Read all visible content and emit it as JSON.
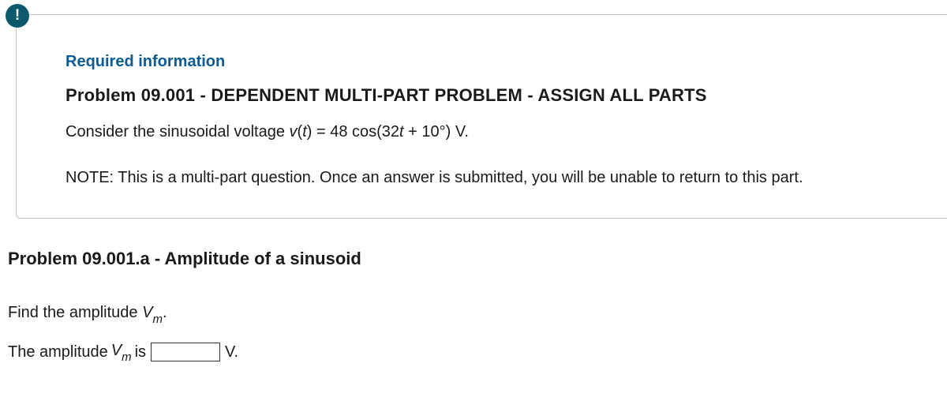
{
  "info_icon": "!",
  "required_label": "Required information",
  "problem_title": "Problem 09.001 - DEPENDENT MULTI-PART PROBLEM - ASSIGN ALL PARTS",
  "problem_desc_prefix": "Consider the sinusoidal voltage ",
  "problem_desc_var_v": "v",
  "problem_desc_var_t_open": "(",
  "problem_desc_var_t": "t",
  "problem_desc_var_t_close": ")",
  "problem_desc_eq": " = 48 cos(32",
  "problem_desc_t2": "t",
  "problem_desc_suffix": " + 10°) V.",
  "note_text": "NOTE: This is a multi-part question. Once an answer is submitted, you will be unable to return to this part.",
  "sub_title": "Problem 09.001.a - Amplitude of a sinusoid",
  "question_prefix": "Find the amplitude ",
  "question_var_v": "V",
  "question_var_m": "m",
  "question_suffix": ".",
  "answer_prefix": "The amplitude ",
  "answer_var_v": "V",
  "answer_var_m": "m",
  "answer_is": " is",
  "answer_unit": "V.",
  "answer_value": ""
}
